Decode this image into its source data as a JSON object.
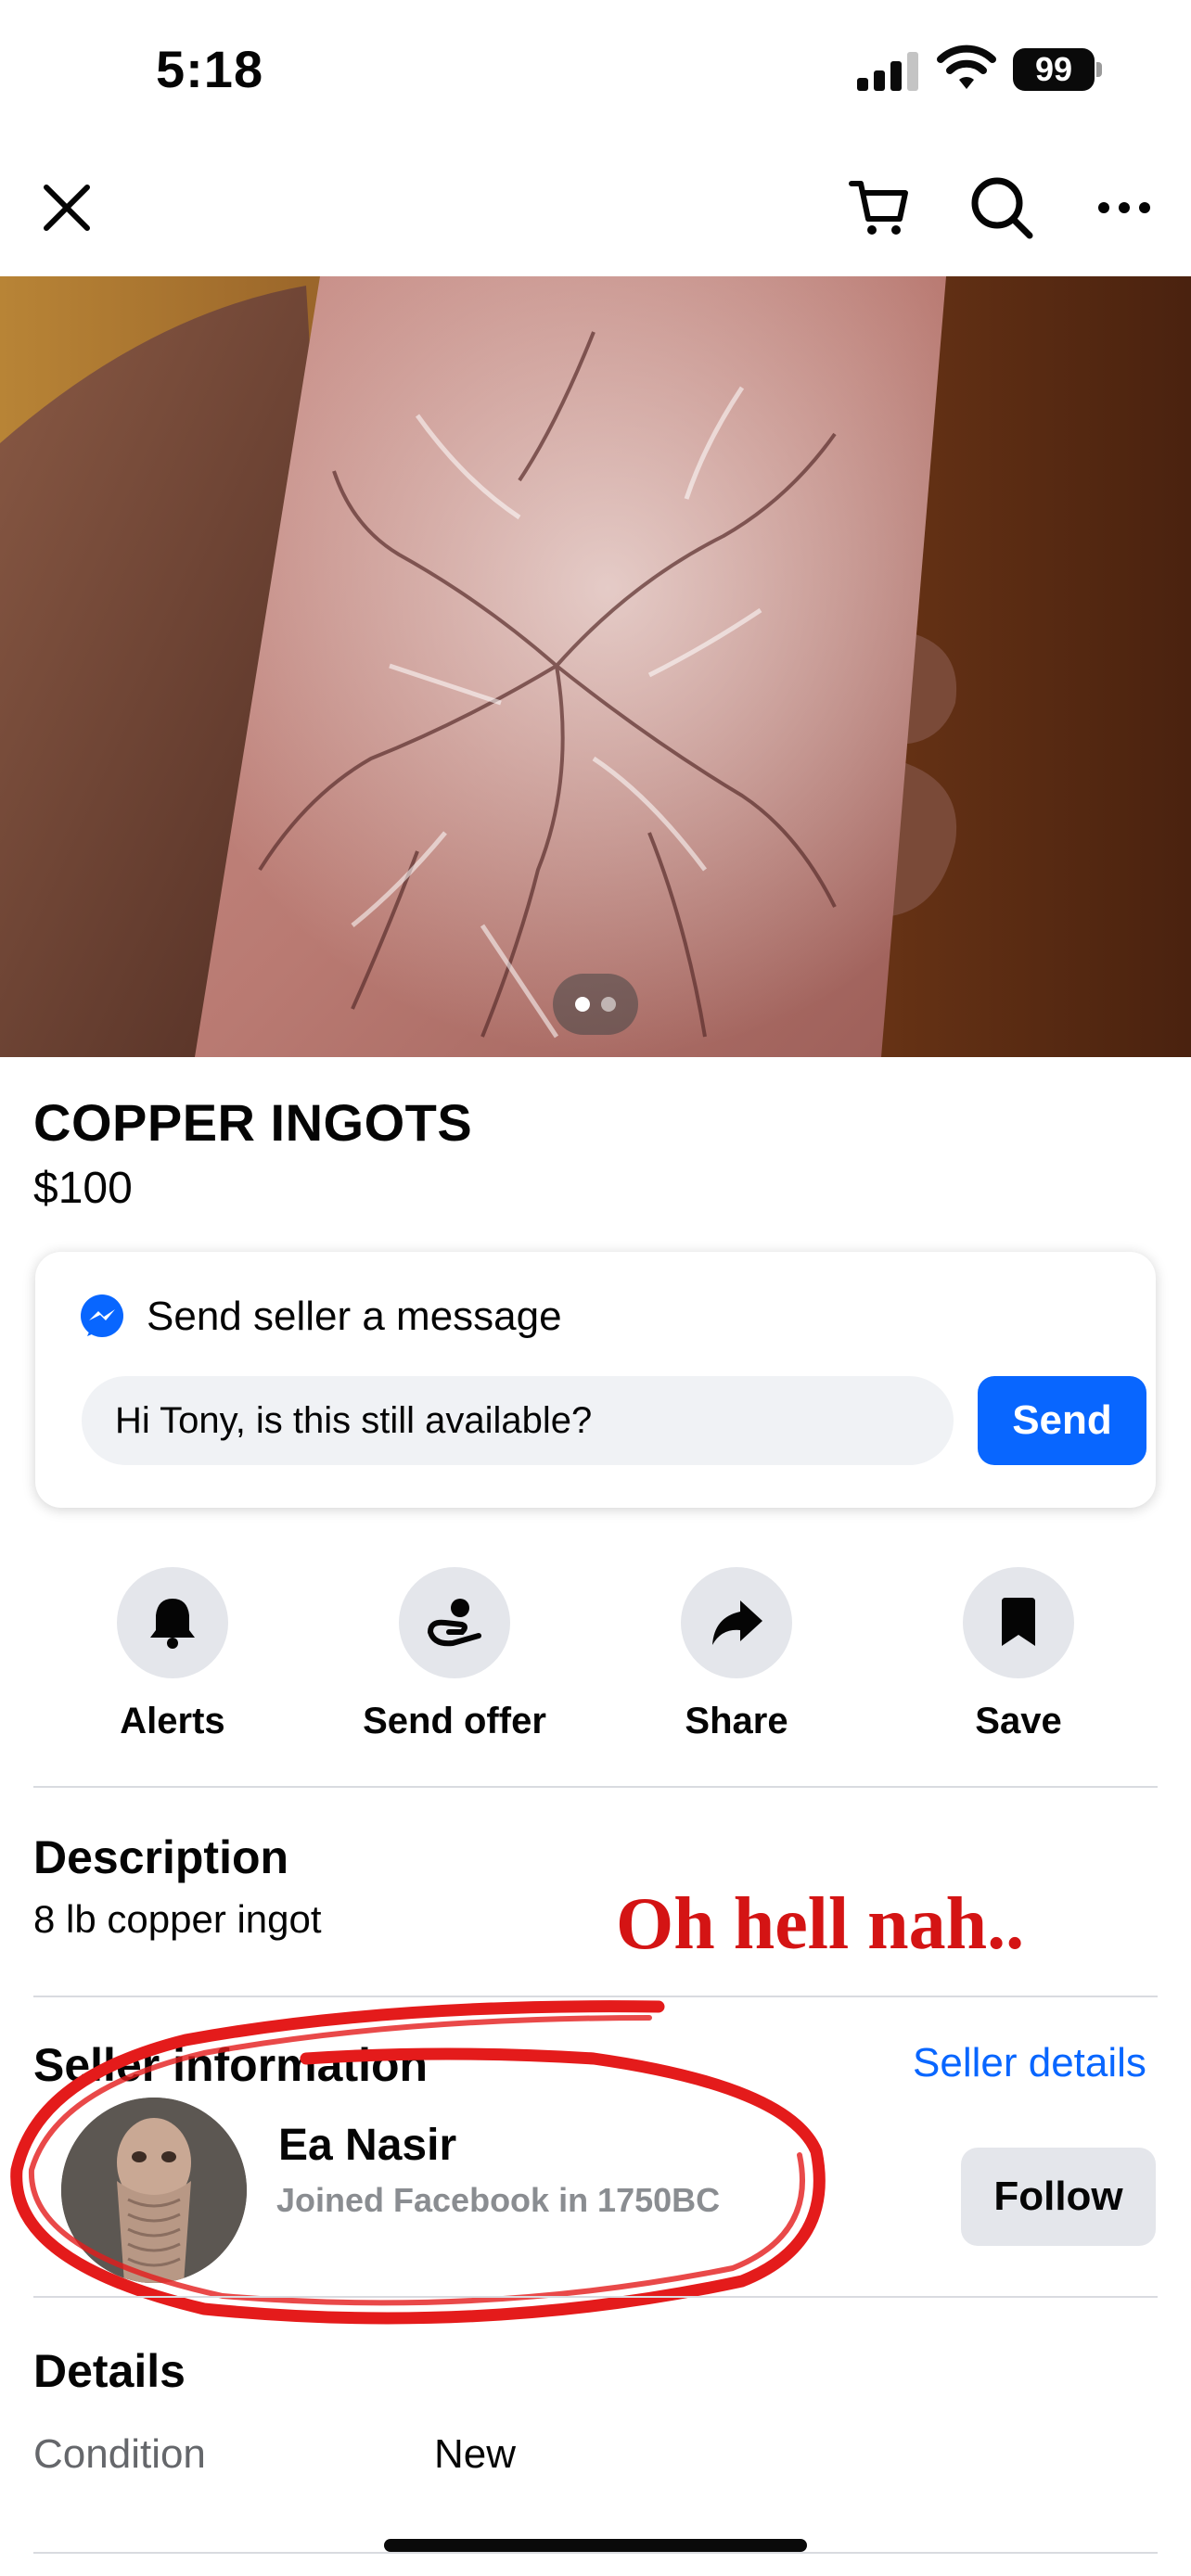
{
  "status_bar": {
    "time": "5:18",
    "battery": "99"
  },
  "nav": {
    "close_icon": "close-icon",
    "cart_icon": "cart-icon",
    "search_icon": "search-icon",
    "more_icon": "more-icon"
  },
  "listing": {
    "title": "COPPER INGOTS",
    "price": "$100",
    "photo_count": 2,
    "photo_index": 1
  },
  "message": {
    "heading": "Send seller a message",
    "input_value": "Hi Tony, is this still available?",
    "send_label": "Send"
  },
  "actions": [
    {
      "label": "Alerts",
      "icon": "bell-icon"
    },
    {
      "label": "Send offer",
      "icon": "offer-hand-icon"
    },
    {
      "label": "Share",
      "icon": "share-arrow-icon"
    },
    {
      "label": "Save",
      "icon": "bookmark-icon"
    }
  ],
  "description": {
    "heading": "Description",
    "text": "8 lb copper ingot"
  },
  "annotation": "Oh hell nah..",
  "seller": {
    "heading": "Seller information",
    "details_link": "Seller details",
    "name": "Ea Nasir",
    "joined": "Joined Facebook in 1750BC",
    "follow_label": "Follow"
  },
  "details": {
    "heading": "Details",
    "condition_label": "Condition",
    "condition_value": "New"
  },
  "colors": {
    "accent": "#0866ff",
    "annotation_red": "#d41414",
    "button_gray": "#e4e6eb"
  }
}
